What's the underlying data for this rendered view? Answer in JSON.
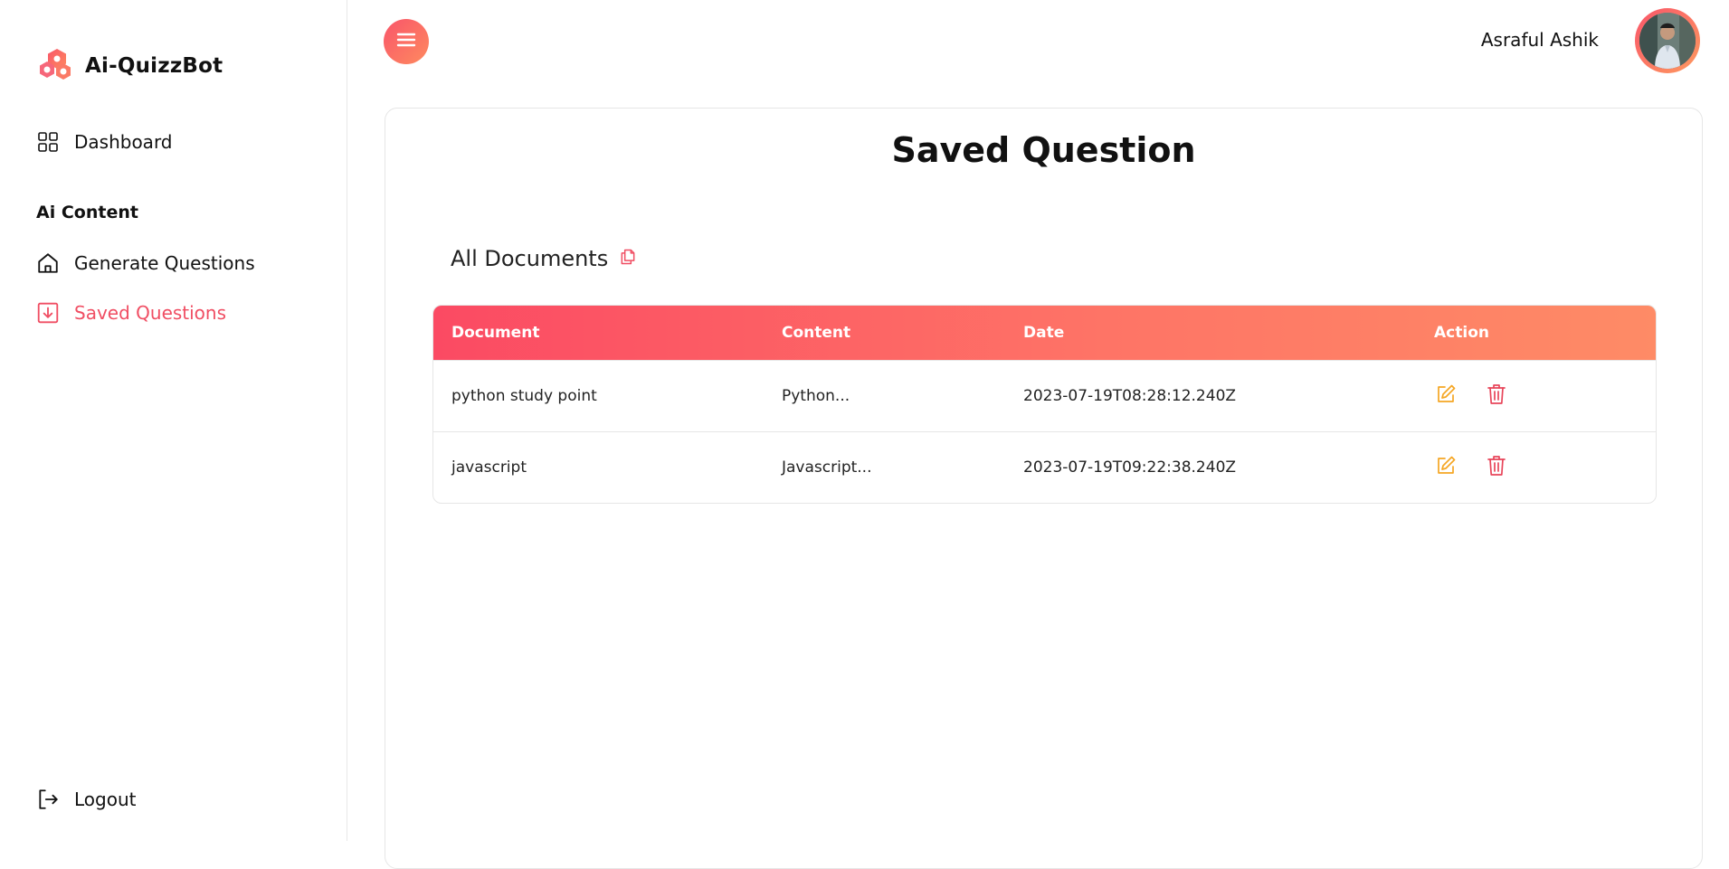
{
  "brand": {
    "name": "Ai-QuizzBot"
  },
  "sidebar": {
    "dashboard_label": "Dashboard",
    "section_label": "Ai Content",
    "items": [
      {
        "label": "Generate Questions",
        "icon": "home-icon",
        "active": false
      },
      {
        "label": "Saved Questions",
        "icon": "download-box-icon",
        "active": true
      }
    ],
    "logout_label": "Logout"
  },
  "header": {
    "user_name": "Asraful Ashik",
    "menu_icon": "hamburger-icon"
  },
  "main": {
    "title": "Saved Question",
    "section_title": "All Documents",
    "table": {
      "columns": [
        "Document",
        "Content",
        "Date",
        "Action"
      ],
      "rows": [
        {
          "document": "python study point",
          "content": "Python...",
          "date": "2023-07-19T08:28:12.240Z"
        },
        {
          "document": "javascript",
          "content": "Javascript...",
          "date": "2023-07-19T09:22:38.240Z"
        }
      ]
    }
  },
  "colors": {
    "accent": "#f04e63",
    "gradient_start": "#fb4a63",
    "gradient_end": "#fe8b66",
    "edit": "#f5a623",
    "delete": "#e8455a"
  }
}
